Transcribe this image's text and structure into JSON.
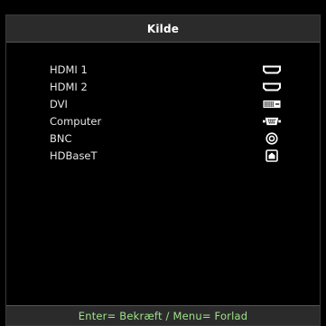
{
  "menu": {
    "title": "Kilde",
    "items": [
      {
        "label": "HDMI 1",
        "icon": "hdmi-icon"
      },
      {
        "label": "HDMI 2",
        "icon": "hdmi-icon"
      },
      {
        "label": "DVI",
        "icon": "dvi-icon"
      },
      {
        "label": "Computer",
        "icon": "vga-icon"
      },
      {
        "label": "BNC",
        "icon": "bnc-icon"
      },
      {
        "label": "HDBaseT",
        "icon": "hdbaset-icon"
      }
    ]
  },
  "footer": {
    "hint": "Enter= Bekræft / Menu= Forlad"
  },
  "colors": {
    "background": "#000000",
    "header_footer": "#2b2b2b",
    "text": "#e6e6e6",
    "hint": "#9fe18a"
  }
}
